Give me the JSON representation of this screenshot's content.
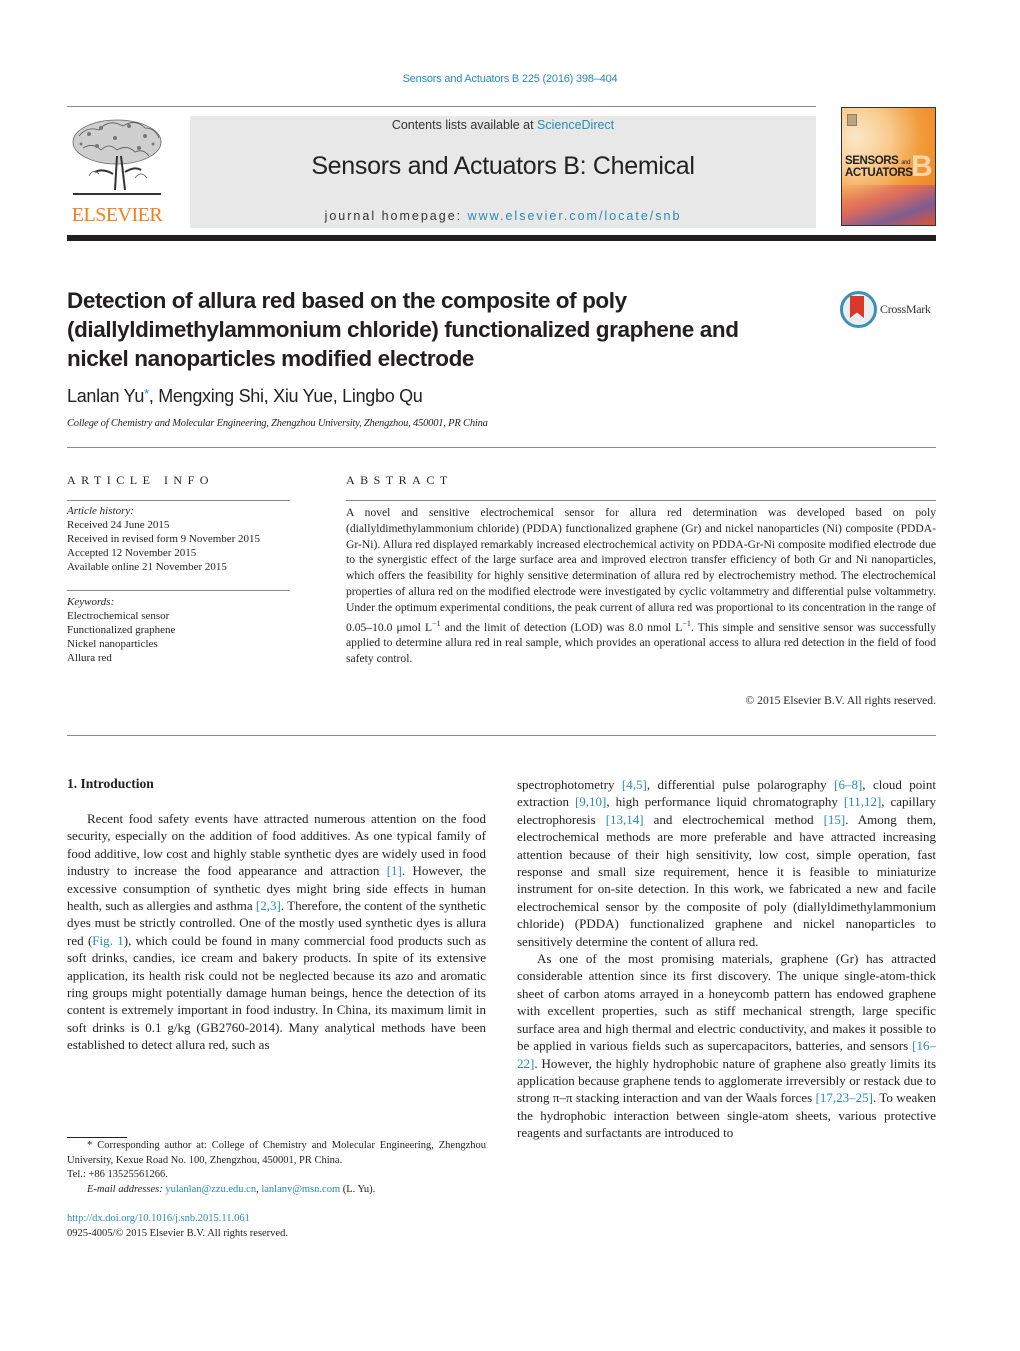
{
  "header": {
    "citation": "Sensors and Actuators B 225 (2016) 398–404",
    "contents_prefix": "Contents lists available at ",
    "contents_link": "ScienceDirect",
    "journal_title": "Sensors and Actuators B: Chemical",
    "homepage_prefix": "journal homepage: ",
    "homepage_link": "www.elsevier.com/locate/snb",
    "publisher_logo_text": "ELSEVIER",
    "cover_line1": "SENSORS",
    "cover_line1_small": "and",
    "cover_line2": "ACTUATORS",
    "cover_letter": "B",
    "accent_color": "#2a8ab5",
    "publisher_color": "#f07f1f"
  },
  "article": {
    "title_lines": [
      "Detection of allura red based on the composite of poly",
      "(diallyldimethylammonium chloride) functionalized graphene and",
      "nickel nanoparticles modified electrode"
    ],
    "crossmark_label": "CrossMark",
    "authors": [
      {
        "name": "Lanlan Yu",
        "mark": "*",
        "sep": ", "
      },
      {
        "name": "Mengxing Shi",
        "mark": "",
        "sep": ", "
      },
      {
        "name": "Xiu Yue",
        "mark": "",
        "sep": ", "
      },
      {
        "name": "Lingbo Qu",
        "mark": "",
        "sep": ""
      }
    ],
    "affiliation": "College of Chemistry and Molecular Engineering, Zhengzhou University, Zhengzhou, 450001, PR China"
  },
  "article_info": {
    "heading": "ARTICLE INFO",
    "history_label": "Article history:",
    "history": [
      "Received 24 June 2015",
      "Received in revised form 9 November 2015",
      "Accepted 12 November 2015",
      "Available online 21 November 2015"
    ],
    "keywords_label": "Keywords:",
    "keywords": [
      "Electrochemical sensor",
      "Functionalized graphene",
      "Nickel nanoparticles",
      "Allura red"
    ]
  },
  "abstract": {
    "heading": "ABSTRACT",
    "part1": "A novel and sensitive electrochemical sensor for allura red determination was developed based on poly (diallyldimethylammonium chloride) (PDDA) functionalized graphene (Gr) and nickel nanoparticles (Ni) composite (PDDA-Gr-Ni). Allura red displayed remarkably increased electrochemical activity on PDDA-Gr-Ni composite modified electrode due to the synergistic effect of the large surface area and improved electron transfer efficiency of both Gr and Ni nanoparticles, which offers the feasibility for highly sensitive determination of allura red by electrochemistry method. The electrochemical properties of allura red on the modified electrode were investigated by cyclic voltammetry and differential pulse voltammetry. Under the optimum experimental conditions, the peak current of allura red was proportional to its concentration in the range of 0.05–10.0 μmol L",
    "sup1": "−1",
    "part2": " and the limit of detection (LOD) was 8.0 nmol L",
    "sup2": "−1",
    "part3": ". This simple and sensitive sensor was successfully applied to determine allura red in real sample, which provides an operational access to allura red detection in the field of food safety control.",
    "copyright": "© 2015 Elsevier B.V. All rights reserved."
  },
  "introduction": {
    "heading": "1.  Introduction",
    "left_column": [
      {
        "t": "Recent food safety events have attracted numerous attention on the food security, especially on the addition of food additives. As one typical family of food additive, low cost and highly stable synthetic dyes are widely used in food industry to increase the food appearance and attraction "
      },
      {
        "ref": "[1]"
      },
      {
        "t": ". However, the excessive consumption of synthetic dyes might bring side effects in human health, such as allergies and asthma "
      },
      {
        "ref": "[2,3]"
      },
      {
        "t": ". Therefore, the content of the synthetic dyes must be strictly controlled. One of the mostly used synthetic dyes is allura red ("
      },
      {
        "ref": "Fig. 1"
      },
      {
        "t": "), which could be found in many commercial food products such as soft drinks, candies, ice cream and bakery products. In spite of its extensive application, its health risk could not be neglected because its azo and aromatic ring groups might potentially damage human beings, hence the detection of its content is extremely important in food industry. In China, its maximum limit in soft drinks is 0.1 g/kg (GB2760-2014). Many analytical methods have been established to detect allura red, such as"
      }
    ],
    "right_para1": [
      {
        "t": "spectrophotometry "
      },
      {
        "ref": "[4,5]"
      },
      {
        "t": ", differential pulse polarography "
      },
      {
        "ref": "[6–8]"
      },
      {
        "t": ", cloud point extraction "
      },
      {
        "ref": "[9,10]"
      },
      {
        "t": ", high performance liquid chromatography "
      },
      {
        "ref": "[11,12]"
      },
      {
        "t": ", capillary electrophoresis "
      },
      {
        "ref": "[13,14]"
      },
      {
        "t": " and electrochemical method "
      },
      {
        "ref": "[15]"
      },
      {
        "t": ". Among them, electrochemical methods are more preferable and have attracted increasing attention because of their high sensitivity, low cost, simple operation, fast response and small size requirement, hence it is feasible to miniaturize instrument for on-site detection. In this work, we fabricated a new and facile electrochemical sensor by the composite of poly (diallyldimethylammonium chloride) (PDDA) functionalized graphene and nickel nanoparticles to sensitively determine the content of allura red."
      }
    ],
    "right_para2": [
      {
        "t": "As one of the most promising materials, graphene (Gr) has attracted considerable attention since its first discovery. The unique single-atom-thick sheet of carbon atoms arrayed in a honeycomb pattern has endowed graphene with excellent properties, such as stiff mechanical strength, large specific surface area and high thermal and electric conductivity, and makes it possible to be applied in various fields such as supercapacitors, batteries, and sensors "
      },
      {
        "ref": "[16–22]"
      },
      {
        "t": ". However, the highly hydrophobic nature of graphene also greatly limits its application because graphene tends to agglomerate irreversibly or restack due to strong π–π stacking interaction and van der Waals forces "
      },
      {
        "ref": "[17,23–25]"
      },
      {
        "t": ". To weaken the hydrophobic interaction between single-atom sheets, various protective reagents and surfactants are introduced to"
      }
    ]
  },
  "footnote": {
    "star_text": "*  Corresponding author at: College of Chemistry and Molecular Engineering, Zhengzhou University, Kexue Road No. 100, Zhengzhou, 450001, PR China.",
    "tel": "Tel.: +86 13525561266.",
    "email_label": "E-mail addresses:",
    "email1": "yulanlan@zzu.edu.cn",
    "email_sep": ", ",
    "email2": "lanlanv@msn.com",
    "email_suffix": " (L. Yu).",
    "doi_link": "http://dx.doi.org/10.1016/j.snb.2015.11.061",
    "issn_line": "0925-4005/© 2015 Elsevier B.V. All rights reserved."
  }
}
